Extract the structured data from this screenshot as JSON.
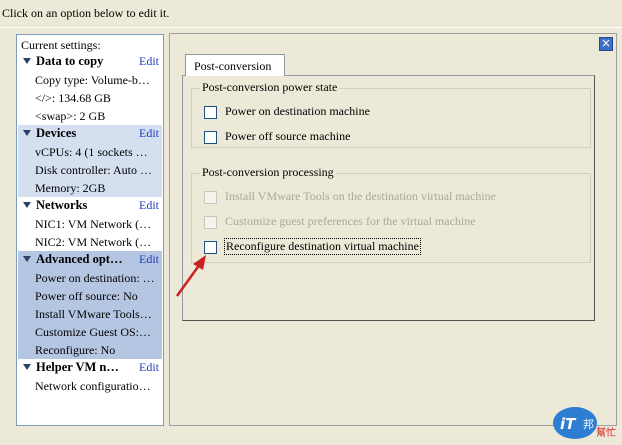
{
  "instruction": "Click on an option below to edit it.",
  "left_panel": {
    "heading": "Current settings:",
    "edit_label": "Edit",
    "sections": [
      {
        "title": "Data to copy",
        "items": [
          "Copy type: Volume-b…",
          "</>: 134.68 GB",
          "<swap>: 2 GB"
        ]
      },
      {
        "title": "Devices",
        "items": [
          "vCPUs: 4 (1 sockets …",
          "Disk controller: Auto …",
          "Memory: 2GB"
        ]
      },
      {
        "title": "Networks",
        "items": [
          "NIC1: VM Network (…",
          "NIC2: VM Network (…"
        ]
      },
      {
        "title": "Advanced opt…",
        "items": [
          "Power on destination: …",
          "Power off source: No",
          "Install VMware Tools…",
          "Customize Guest OS:…",
          "Reconfigure: No"
        ]
      },
      {
        "title": "Helper VM n…",
        "items": [
          "Network configuratio…"
        ]
      }
    ]
  },
  "right_panel": {
    "tab_label": "Post-conversion",
    "power_group": {
      "title": "Post-conversion power state",
      "options": [
        {
          "label": "Power on destination machine",
          "checked": false,
          "enabled": true
        },
        {
          "label": "Power off source machine",
          "checked": false,
          "enabled": true
        }
      ]
    },
    "processing_group": {
      "title": "Post-conversion processing",
      "options": [
        {
          "label": "Install VMware Tools on the destination virtual machine",
          "checked": false,
          "enabled": false
        },
        {
          "label": "Customize guest preferences for the virtual machine",
          "checked": false,
          "enabled": false
        },
        {
          "label": "Reconfigure destination virtual machine",
          "checked": false,
          "enabled": true
        }
      ]
    }
  },
  "watermark": {
    "brand": "iT邦",
    "sub": "幫忙"
  },
  "colors": {
    "accent_blue": "#3a6fc4",
    "selection": "#b5c6e3",
    "highlight": "#d4dff0",
    "arrow": "#cc1f1f"
  }
}
